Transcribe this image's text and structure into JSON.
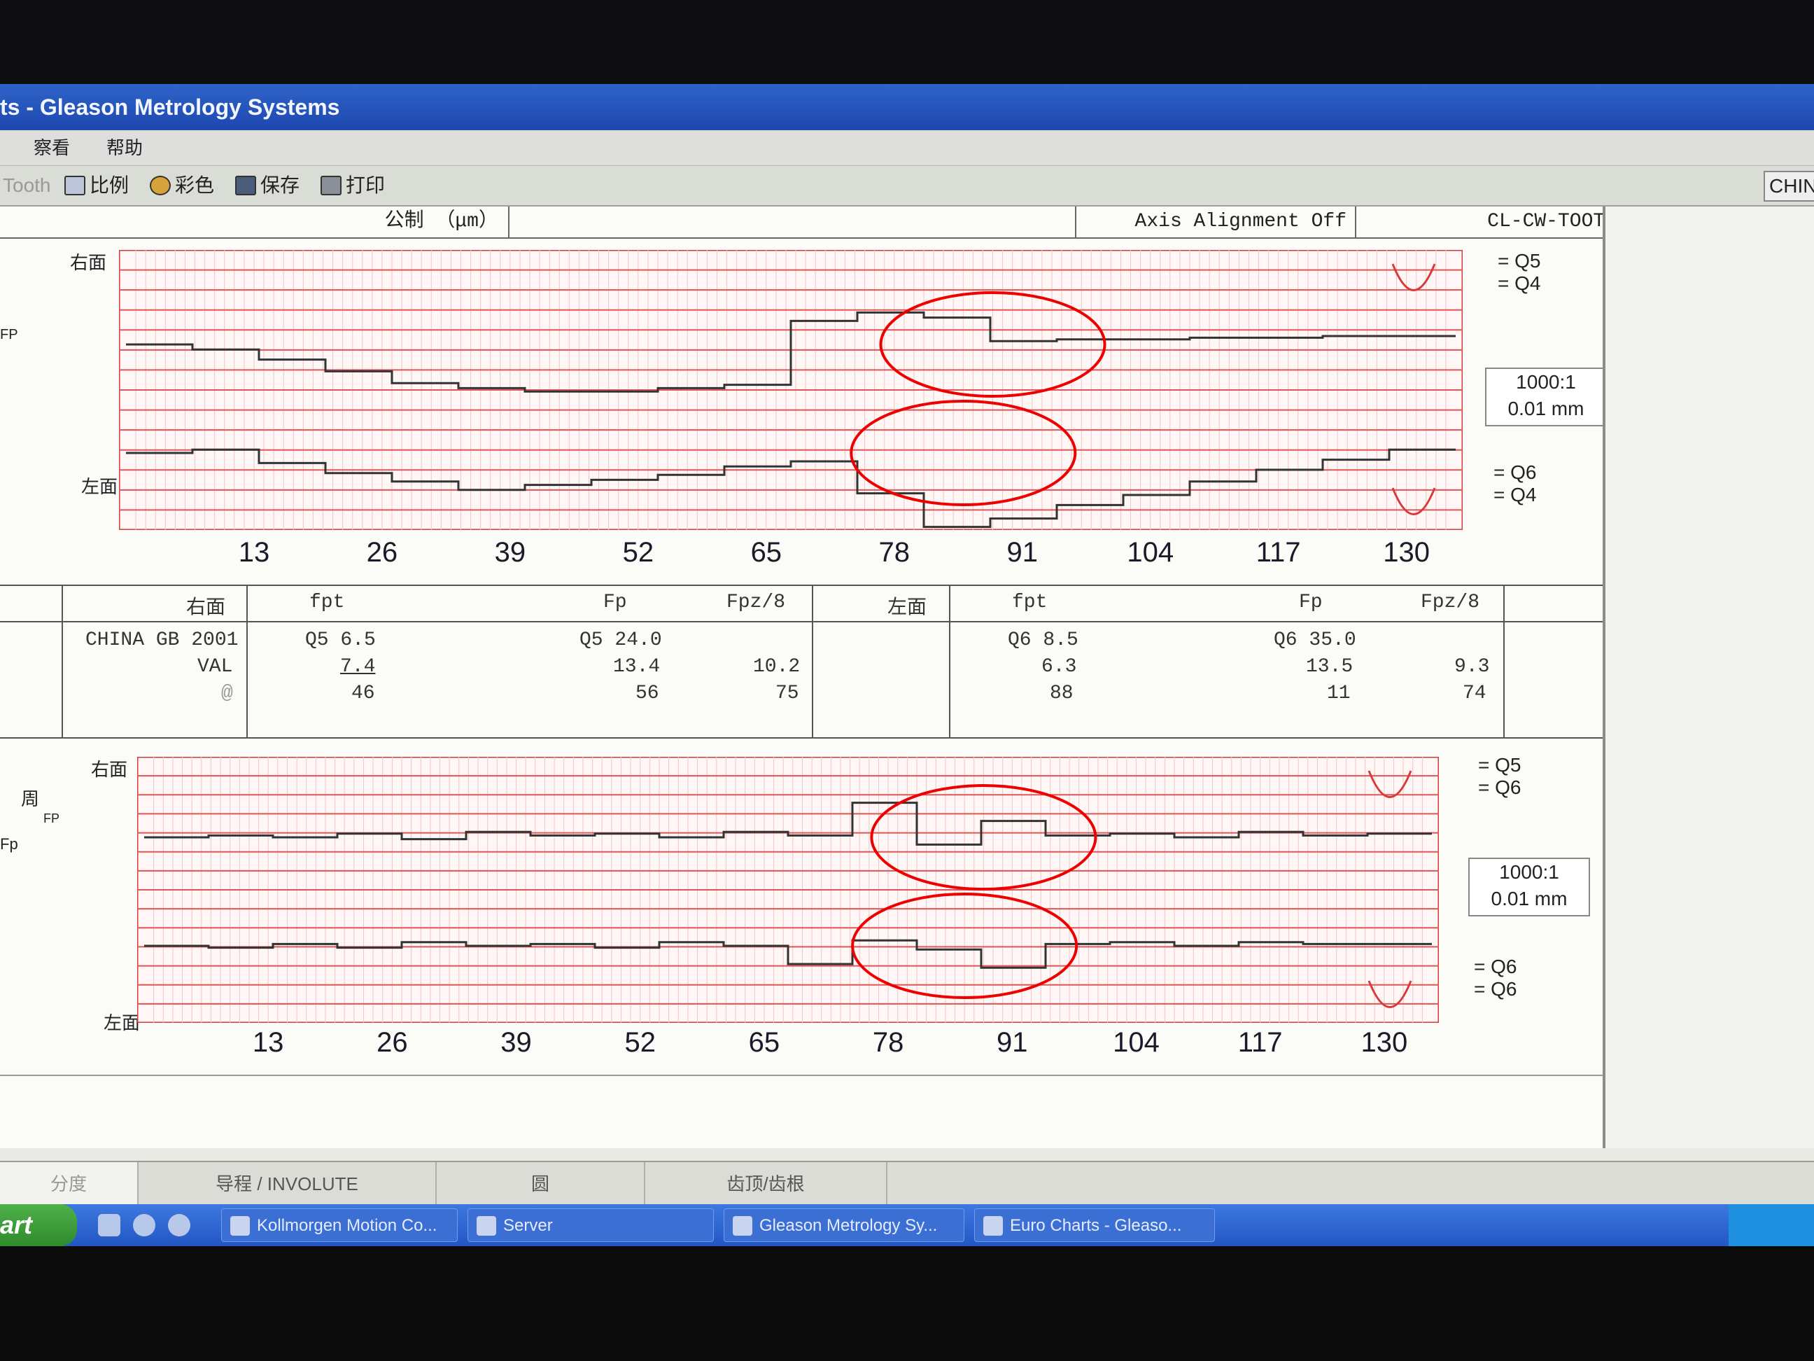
{
  "window": {
    "title": "ts - Gleason Metrology Systems"
  },
  "menu": [
    {
      "label": "察看"
    },
    {
      "label": "帮助"
    }
  ],
  "toolbar": {
    "partial_label": "Tooth",
    "items": [
      {
        "label": "比例",
        "icon": "magnifier-icon"
      },
      {
        "label": "彩色",
        "icon": "palette-icon"
      },
      {
        "label": "保存",
        "icon": "floppy-disk-icon"
      },
      {
        "label": "打印",
        "icon": "printer-icon"
      }
    ],
    "right_button": "CHIN"
  },
  "header": {
    "units": "公制 （μm）",
    "alignment": "Axis Alignment Off",
    "mode": "CL-CW-TOOTH"
  },
  "chart_data": [
    {
      "type": "line",
      "title": "",
      "x_ticks": [
        13,
        26,
        39,
        52,
        65,
        78,
        91,
        104,
        117,
        130
      ],
      "side_top": "右面",
      "side_bottom": "左面",
      "left_labels": [
        "FP"
      ],
      "top_q": [
        "Q5",
        "Q4"
      ],
      "bottom_q": [
        "Q6",
        "Q4"
      ],
      "scale": "1000:1",
      "scale_unit": "0.01 mm",
      "grid": true,
      "series": [
        {
          "values": [
            0,
            -0.3,
            -0.9,
            -1.6,
            -2.3,
            -2.6,
            -2.8,
            -2.8,
            -2.6,
            -2.4,
            1.4,
            1.9,
            1.6,
            0.2,
            0.3,
            0.3,
            0.4,
            0.4,
            0.5,
            0.5
          ]
        },
        {
          "values": [
            0,
            0.2,
            -0.6,
            -1.2,
            -1.7,
            -2.2,
            -1.9,
            -1.6,
            -1.3,
            -0.8,
            -0.5,
            -2.4,
            -4.4,
            -3.9,
            -3.1,
            -2.5,
            -1.7,
            -1.0,
            -0.4,
            0.2
          ]
        }
      ],
      "highlights": [
        {
          "x": 88
        },
        {
          "x": 85
        }
      ]
    },
    {
      "type": "line",
      "title": "",
      "x_ticks": [
        13,
        26,
        39,
        52,
        65,
        78,
        91,
        104,
        117,
        130
      ],
      "side_top": "右面",
      "side_bottom": "左面",
      "left_labels": [
        "周",
        "FP",
        "Fp"
      ],
      "top_q": [
        "Q5",
        "Q6"
      ],
      "bottom_q": [
        "Q6",
        "Q6"
      ],
      "scale": "1000:1",
      "scale_unit": "0.01 mm",
      "grid": true,
      "series": [
        {
          "values": [
            0,
            0.1,
            0.0,
            0.2,
            -0.1,
            0.3,
            0.1,
            0.2,
            0.0,
            0.3,
            0.1,
            1.9,
            -0.4,
            0.9,
            0.1,
            0.2,
            0.0,
            0.3,
            0.1,
            0.2
          ]
        },
        {
          "values": [
            0,
            -0.1,
            0.1,
            -0.1,
            0.2,
            0.0,
            0.1,
            -0.1,
            0.2,
            0.0,
            -1.0,
            0.3,
            -0.2,
            -1.2,
            0.1,
            0.2,
            0.0,
            0.2,
            0.1,
            0.1
          ]
        }
      ],
      "highlights": [
        {
          "x": 88
        },
        {
          "x": 86
        }
      ]
    }
  ],
  "table": {
    "right": {
      "title": "右面",
      "cols": [
        "fpt",
        "Fp",
        "Fpz/8"
      ],
      "standard": "CHINA GB 2001",
      "val_label": "VAL",
      "at_label": "@",
      "fpt": [
        "Q5 6.5",
        "7.4",
        "46"
      ],
      "Fp": [
        "Q5 24.0",
        "13.4",
        "56"
      ],
      "Fpz8": [
        "",
        "10.2",
        "75"
      ]
    },
    "left": {
      "title": "左面",
      "cols": [
        "fpt",
        "Fp",
        "Fpz/8"
      ],
      "fpt": [
        "Q6 8.5",
        "6.3",
        "88"
      ],
      "Fp": [
        "Q6 35.0",
        "13.5",
        "11"
      ],
      "Fpz8": [
        "",
        "9.3",
        "74"
      ]
    }
  },
  "tabs": [
    {
      "label": "分度"
    },
    {
      "label": "导程 / INVOLUTE"
    },
    {
      "label": "圆"
    },
    {
      "label": "齿顶/齿根"
    }
  ],
  "taskbar": {
    "start": "art",
    "items": [
      {
        "label": "Kollmorgen Motion Co..."
      },
      {
        "label": "Server"
      },
      {
        "label": "Gleason Metrology Sy..."
      },
      {
        "label": "Euro Charts - Gleaso..."
      }
    ]
  },
  "colors": {
    "red": "#d63a3a",
    "trace": "#333333",
    "titlebar": "#2455bb"
  }
}
